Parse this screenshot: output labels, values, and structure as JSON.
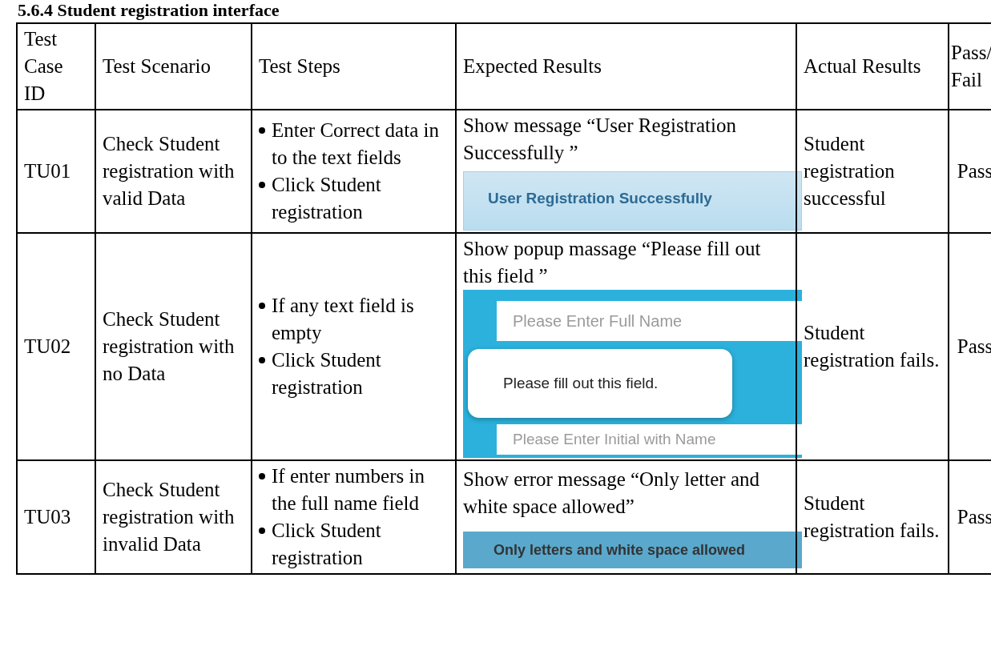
{
  "heading": "5.6.4 Student registration interface",
  "table": {
    "columns": [
      "Test Case ID",
      "Test Scenario",
      "Test Steps",
      "Expected Results",
      "Actual Results",
      "Pass/ Fail"
    ],
    "rows": [
      {
        "id": "TU01",
        "scenario": "Check Student registration with valid Data",
        "steps": [
          "Enter Correct data in to the text fields",
          "Click Student registration"
        ],
        "expected": "Show message “User Registration Successfully ”",
        "inset": {
          "kind": "success-banner",
          "message": "User Registration Successfully"
        },
        "actual": "Student registration successful",
        "result": "Pass"
      },
      {
        "id": "TU02",
        "scenario": "Check Student registration with no Data",
        "steps": [
          "If any text field is empty",
          "Click Student registration"
        ],
        "expected": "Show popup massage “Please fill out this field ”",
        "inset": {
          "kind": "validation-popup",
          "placeholder": "Please Enter Full Name",
          "message": "Please fill out this field.",
          "placeholder_2": "Please Enter Initial with Name"
        },
        "actual": "Student registration fails.",
        "result": "Pass"
      },
      {
        "id": "TU03",
        "scenario": "Check Student registration with invalid Data",
        "steps": [
          "If enter numbers in the full name field",
          "Click Student registration"
        ],
        "expected": "Show error message “Only letter and white space allowed”",
        "inset": {
          "kind": "error-banner",
          "message": "Only letters and white space allowed"
        },
        "actual": "Student registration fails.",
        "result": "Pass"
      }
    ]
  }
}
